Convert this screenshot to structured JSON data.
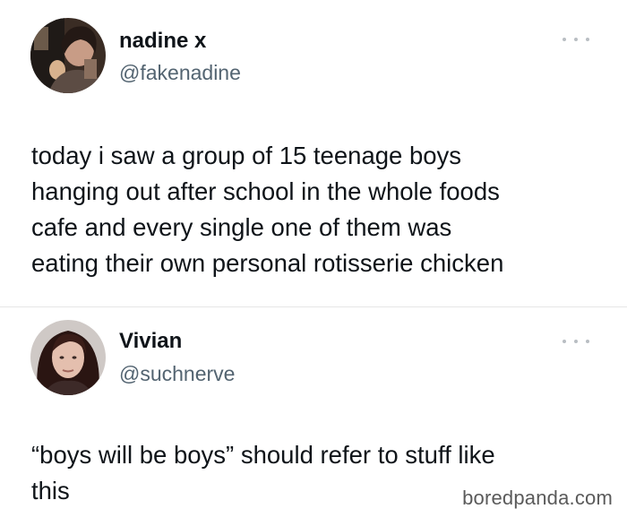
{
  "tweets": [
    {
      "display_name": "nadine x",
      "handle": "@fakenadine",
      "text": "today i saw a group of 15 teenage boys\nhanging out after school in the whole foods\ncafe and every single one of them was\neating their own personal rotisserie chicken",
      "more_icon": "more-horizontal-icon"
    },
    {
      "display_name": "Vivian",
      "handle": "@suchnerve",
      "text": "“boys will be boys” should refer to stuff like\nthis",
      "more_icon": "more-horizontal-icon"
    }
  ],
  "watermark": "boredpanda.com",
  "colors": {
    "text_primary": "#0f1419",
    "text_secondary": "#536471",
    "divider": "#e6e6e6",
    "more_dots": "#b9bec3"
  }
}
